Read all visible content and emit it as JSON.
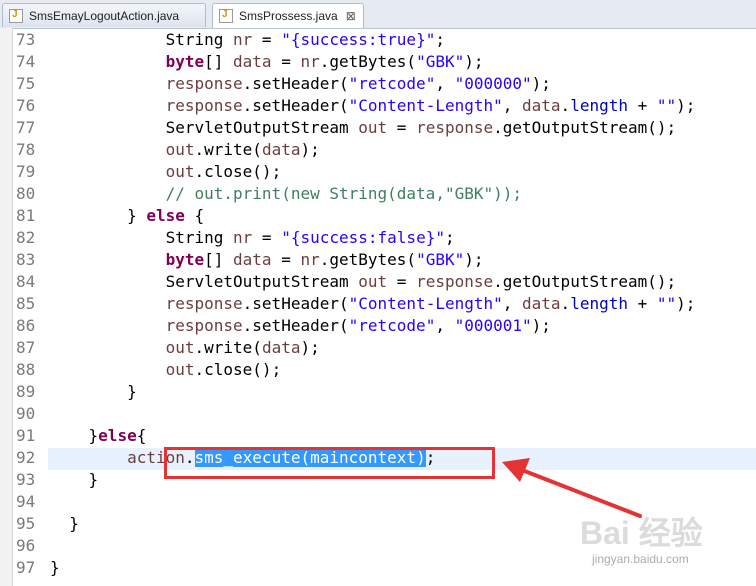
{
  "tabs": [
    {
      "label": "SmsEmayLogoutAction.java",
      "active": false
    },
    {
      "label": "SmsProssess.java",
      "active": true,
      "close": "⊠"
    }
  ],
  "code_lines": [
    {
      "n": "73",
      "t": [
        [
          "            String ",
          ""
        ],
        [
          "nr",
          "var"
        ],
        [
          " = ",
          ""
        ],
        [
          "\"{success:true}\"",
          "str"
        ],
        [
          ";",
          ""
        ]
      ]
    },
    {
      "n": "74",
      "t": [
        [
          "            ",
          ""
        ],
        [
          "byte",
          "kw"
        ],
        [
          "[] ",
          ""
        ],
        [
          "data",
          "var"
        ],
        [
          " = ",
          ""
        ],
        [
          "nr",
          "var"
        ],
        [
          ".getBytes(",
          ""
        ],
        [
          "\"GBK\"",
          "str"
        ],
        [
          ");",
          ""
        ]
      ]
    },
    {
      "n": "75",
      "t": [
        [
          "            ",
          ""
        ],
        [
          "response",
          "var"
        ],
        [
          ".setHeader(",
          ""
        ],
        [
          "\"retcode\"",
          "str"
        ],
        [
          ", ",
          ""
        ],
        [
          "\"000000\"",
          "str"
        ],
        [
          ");",
          ""
        ]
      ]
    },
    {
      "n": "76",
      "t": [
        [
          "            ",
          ""
        ],
        [
          "response",
          "var"
        ],
        [
          ".setHeader(",
          ""
        ],
        [
          "\"Content-Length\"",
          "str"
        ],
        [
          ", ",
          ""
        ],
        [
          "data",
          "var"
        ],
        [
          ".",
          ""
        ],
        [
          "length",
          "fld"
        ],
        [
          " + ",
          ""
        ],
        [
          "\"\"",
          "str"
        ],
        [
          ");",
          ""
        ]
      ]
    },
    {
      "n": "77",
      "t": [
        [
          "            ServletOutputStream ",
          ""
        ],
        [
          "out",
          "var"
        ],
        [
          " = ",
          ""
        ],
        [
          "response",
          "var"
        ],
        [
          ".getOutputStream();",
          ""
        ]
      ]
    },
    {
      "n": "78",
      "t": [
        [
          "            ",
          ""
        ],
        [
          "out",
          "var"
        ],
        [
          ".write(",
          ""
        ],
        [
          "data",
          "var"
        ],
        [
          ");",
          ""
        ]
      ]
    },
    {
      "n": "79",
      "t": [
        [
          "            ",
          ""
        ],
        [
          "out",
          "var"
        ],
        [
          ".close();",
          ""
        ]
      ]
    },
    {
      "n": "80",
      "t": [
        [
          "            ",
          ""
        ],
        [
          "// out.print(new String(data,\"GBK\"));",
          "cm"
        ]
      ]
    },
    {
      "n": "81",
      "t": [
        [
          "        } ",
          ""
        ],
        [
          "else",
          "kw"
        ],
        [
          " {",
          ""
        ]
      ]
    },
    {
      "n": "82",
      "t": [
        [
          "            String ",
          ""
        ],
        [
          "nr",
          "var"
        ],
        [
          " = ",
          ""
        ],
        [
          "\"{success:false}\"",
          "str"
        ],
        [
          ";",
          ""
        ]
      ]
    },
    {
      "n": "83",
      "t": [
        [
          "            ",
          ""
        ],
        [
          "byte",
          "kw"
        ],
        [
          "[] ",
          ""
        ],
        [
          "data",
          "var"
        ],
        [
          " = ",
          ""
        ],
        [
          "nr",
          "var"
        ],
        [
          ".getBytes(",
          ""
        ],
        [
          "\"GBK\"",
          "str"
        ],
        [
          ");",
          ""
        ]
      ]
    },
    {
      "n": "84",
      "t": [
        [
          "            ServletOutputStream ",
          ""
        ],
        [
          "out",
          "var"
        ],
        [
          " = ",
          ""
        ],
        [
          "response",
          "var"
        ],
        [
          ".getOutputStream();",
          ""
        ]
      ]
    },
    {
      "n": "85",
      "t": [
        [
          "            ",
          ""
        ],
        [
          "response",
          "var"
        ],
        [
          ".setHeader(",
          ""
        ],
        [
          "\"Content-Length\"",
          "str"
        ],
        [
          ", ",
          ""
        ],
        [
          "data",
          "var"
        ],
        [
          ".",
          ""
        ],
        [
          "length",
          "fld"
        ],
        [
          " + ",
          ""
        ],
        [
          "\"\"",
          "str"
        ],
        [
          ");",
          ""
        ]
      ]
    },
    {
      "n": "86",
      "t": [
        [
          "            ",
          ""
        ],
        [
          "response",
          "var"
        ],
        [
          ".setHeader(",
          ""
        ],
        [
          "\"retcode\"",
          "str"
        ],
        [
          ", ",
          ""
        ],
        [
          "\"000001\"",
          "str"
        ],
        [
          ");",
          ""
        ]
      ]
    },
    {
      "n": "87",
      "t": [
        [
          "            ",
          ""
        ],
        [
          "out",
          "var"
        ],
        [
          ".write(",
          ""
        ],
        [
          "data",
          "var"
        ],
        [
          ");",
          ""
        ]
      ]
    },
    {
      "n": "88",
      "t": [
        [
          "            ",
          ""
        ],
        [
          "out",
          "var"
        ],
        [
          ".close();",
          ""
        ]
      ]
    },
    {
      "n": "89",
      "t": [
        [
          "        }",
          ""
        ]
      ]
    },
    {
      "n": "90",
      "t": []
    },
    {
      "n": "91",
      "t": [
        [
          "    }",
          ""
        ],
        [
          "else",
          "kw"
        ],
        [
          "{",
          ""
        ]
      ]
    },
    {
      "n": "92",
      "t": [
        [
          "        ",
          ""
        ],
        [
          "action",
          "var"
        ],
        [
          ".",
          ""
        ],
        [
          "sms_execute(",
          "sel"
        ],
        [
          "maincontext",
          "sel"
        ],
        [
          ")",
          "sel"
        ],
        [
          ";",
          ""
        ]
      ]
    },
    {
      "n": "93",
      "t": [
        [
          "    }",
          ""
        ]
      ]
    },
    {
      "n": "94",
      "t": []
    },
    {
      "n": "95",
      "t": [
        [
          "  }",
          ""
        ]
      ]
    },
    {
      "n": "96",
      "t": []
    },
    {
      "n": "97",
      "t": [
        [
          "}",
          ""
        ]
      ]
    }
  ],
  "watermark": {
    "brand": "Bai 经验",
    "url": "jingyan.baidu.com"
  },
  "colors": {
    "keyword": "#7f0055",
    "string": "#2a00ff",
    "variable": "#6a3e3e",
    "comment": "#3f7f5f",
    "selection": "#3399ff",
    "annotation": "#e53333"
  }
}
